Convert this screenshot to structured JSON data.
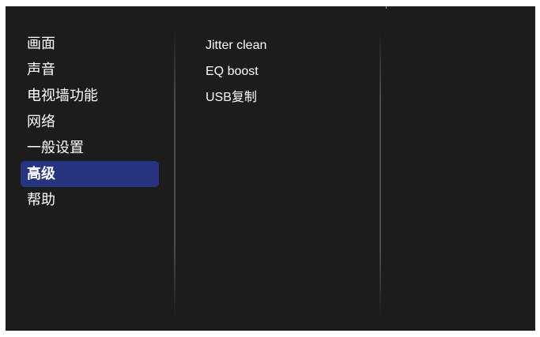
{
  "main_menu": {
    "items": [
      {
        "label": "画面"
      },
      {
        "label": "声音"
      },
      {
        "label": "电视墙功能"
      },
      {
        "label": "网络"
      },
      {
        "label": "一般设置"
      },
      {
        "label": "高级",
        "selected": true
      },
      {
        "label": "帮助"
      }
    ],
    "selected_label": "高级"
  },
  "sub_menu": {
    "items": [
      {
        "label": "Jitter clean"
      },
      {
        "label": "EQ boost"
      },
      {
        "label": "USB复制"
      }
    ]
  },
  "colors": {
    "background": "#1c1c1c",
    "selection_highlight": "#26337f",
    "text": "#ffffff"
  }
}
